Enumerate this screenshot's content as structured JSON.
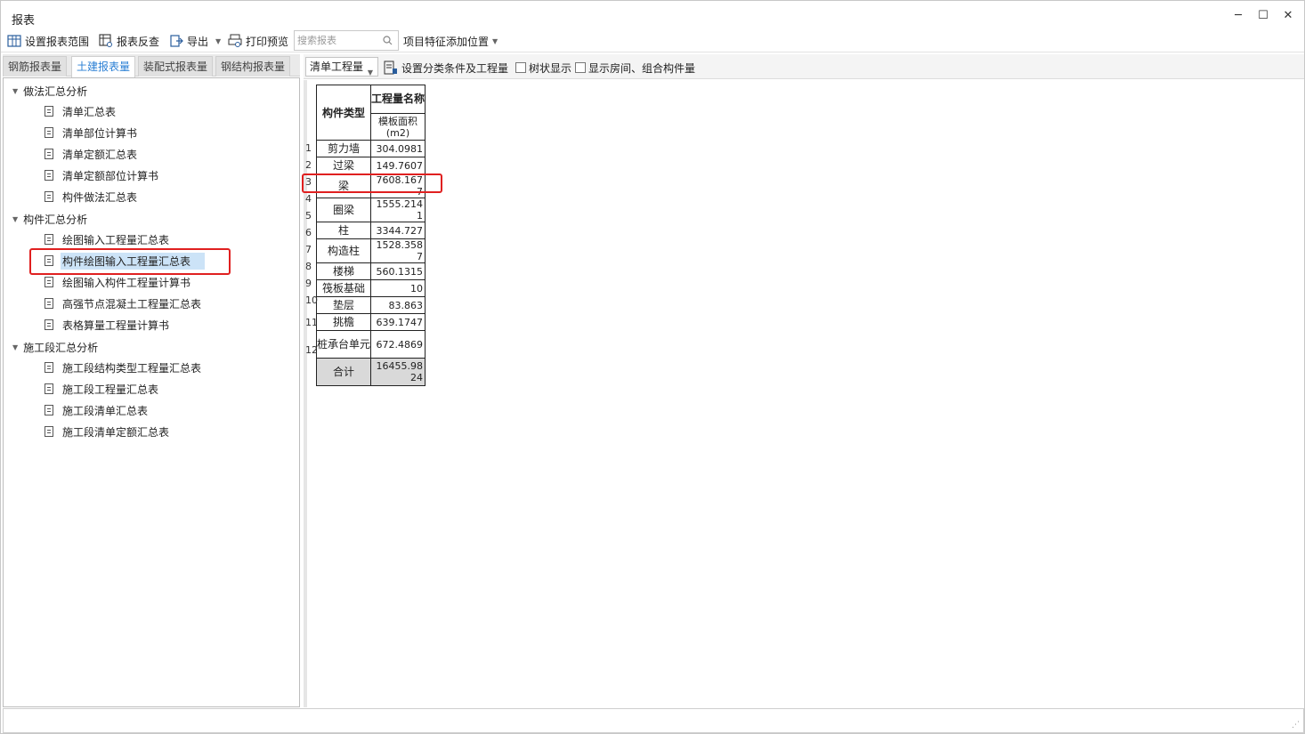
{
  "window": {
    "title": "报表",
    "minimize_glyph": "─",
    "maximize_glyph": "☐",
    "close_glyph": "✕"
  },
  "toolbar": {
    "set_range": "设置报表范围",
    "reverse_check": "报表反查",
    "export": "导出",
    "print_preview": "打印预览",
    "search_placeholder": "搜索报表",
    "feature_position": "项目特征添加位置"
  },
  "left_tabs": [
    "钢筋报表量",
    "土建报表量",
    "装配式报表量",
    "钢结构报表量"
  ],
  "active_left_tab": "土建报表量",
  "tree": {
    "groups": [
      {
        "label": "做法汇总分析",
        "items": [
          "清单汇总表",
          "清单部位计算书",
          "清单定额汇总表",
          "清单定额部位计算书",
          "构件做法汇总表"
        ]
      },
      {
        "label": "构件汇总分析",
        "items": [
          "绘图输入工程量汇总表",
          "构件绘图输入工程量汇总表",
          "绘图输入构件工程量计算书",
          "高强节点混凝土工程量汇总表",
          "表格算量工程量计算书"
        ]
      },
      {
        "label": "施工段汇总分析",
        "items": [
          "施工段结构类型工程量汇总表",
          "施工段工程量汇总表",
          "施工段清单汇总表",
          "施工段清单定额汇总表"
        ]
      }
    ],
    "selected_item": "构件绘图输入工程量汇总表"
  },
  "right_toolbar": {
    "select_value": "清单工程量",
    "set_conditions": "设置分类条件及工程量",
    "tree_display": "树状显示",
    "show_rooms": "显示房间、组合构件量"
  },
  "report": {
    "header_col1": "构件类型",
    "header_col2_top": "工程量名称",
    "header_col2_sub": "模板面积(m2)",
    "rows": [
      {
        "no": "1",
        "type": "剪力墙",
        "value": "304.0981"
      },
      {
        "no": "2",
        "type": "过梁",
        "value": "149.7607"
      },
      {
        "no": "3",
        "type": "梁",
        "value": "7608.1677"
      },
      {
        "no": "4",
        "type": "圈梁",
        "value": "1555.2141"
      },
      {
        "no": "5",
        "type": "柱",
        "value": "3344.727"
      },
      {
        "no": "6",
        "type": "构造柱",
        "value": "1528.3587"
      },
      {
        "no": "7",
        "type": "楼梯",
        "value": "560.1315"
      },
      {
        "no": "8",
        "type": "筏板基础",
        "value": "10"
      },
      {
        "no": "9",
        "type": "垫层",
        "value": "83.863"
      },
      {
        "no": "10",
        "type": "挑檐",
        "value": "639.1747"
      },
      {
        "no": "11",
        "type": "桩承台单元",
        "value": "672.4869"
      },
      {
        "no": "12",
        "type": "合计",
        "value": "16455.9824"
      }
    ]
  },
  "colors": {
    "accent_tab": "#2a7fd4",
    "selection": "#cce3f7",
    "highlight_box": "#e02020",
    "total_row_bg": "#d9d9d9"
  }
}
